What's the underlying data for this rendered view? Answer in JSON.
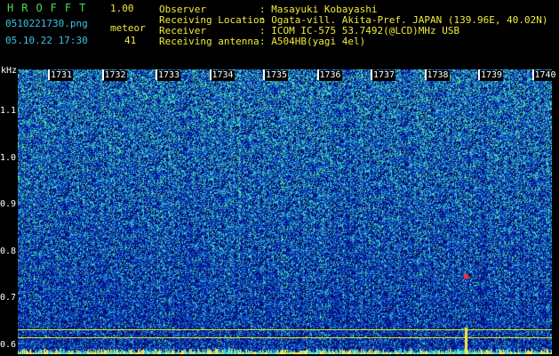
{
  "header": {
    "app_title": "HROFFT",
    "version": "1.00",
    "filename": "0510221730.png",
    "datetime": "05.10.22 17:30",
    "meteor_label": "meteor",
    "meteor_count": "41"
  },
  "station": {
    "observer_label": "Observer",
    "observer_value": ": Masayuki Kobayashi",
    "location_label": "Receiving Location",
    "location_value": ": Ogata-vill. Akita-Pref. JAPAN (139.96E, 40.02N)",
    "receiver_label": "Receiver",
    "receiver_value": ": ICOM IC-575 53.7492(@LCD)MHz USB",
    "antenna_label": "Receiving antenna",
    "antenna_value": ": A504HB(yagi 4el)"
  },
  "axis": {
    "unit": "kHz",
    "freq_labels": [
      "1.1",
      "1.0",
      "0.9",
      "0.8",
      "0.7",
      "0.6"
    ],
    "freq_values": [
      1.1,
      1.0,
      0.9,
      0.8,
      0.7,
      0.6
    ],
    "freq_range": [
      0.58,
      1.19
    ],
    "time_labels": [
      "1731",
      "1732",
      "1733",
      "1734",
      "1735",
      "1736",
      "1737",
      "1738",
      "1739",
      "1740"
    ]
  },
  "colors": {
    "background": "#000000",
    "noise_low": "#0a1b8a",
    "noise_high": "#1fd3c0",
    "text_green": "#4cd94c",
    "text_cyan": "#39c3e6",
    "text_yellow": "#f0ea3c",
    "marker_red": "#ff3030"
  }
}
